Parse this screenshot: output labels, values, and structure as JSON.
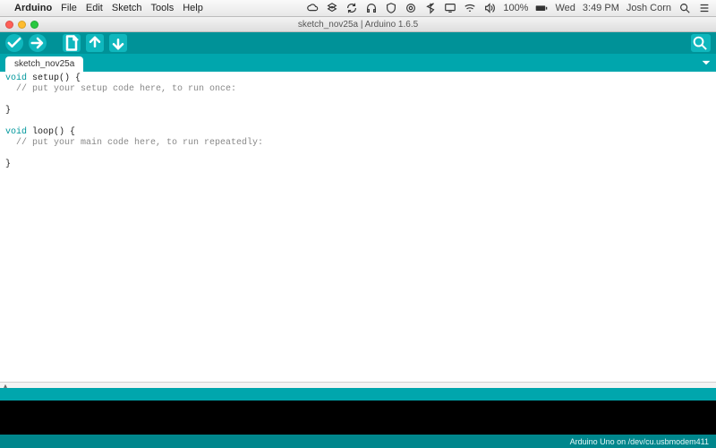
{
  "menubar": {
    "app": "Arduino",
    "items": [
      "File",
      "Edit",
      "Sketch",
      "Tools",
      "Help"
    ],
    "tray": {
      "battery": "100%",
      "day": "Wed",
      "time": "3:49 PM",
      "user": "Josh Corn"
    }
  },
  "window": {
    "title": "sketch_nov25a | Arduino 1.6.5"
  },
  "toolbar": {
    "verify": "verify",
    "upload": "upload",
    "new": "new",
    "open": "open",
    "save": "save",
    "serial": "serial-monitor"
  },
  "tabs": {
    "items": [
      {
        "label": "sketch_nov25a"
      }
    ]
  },
  "code": {
    "l1_kw": "void",
    "l1_rest": " setup() {",
    "l2": "  // put your setup code here, to run once:",
    "l3": "",
    "l4": "}",
    "l5": "",
    "l6_kw": "void",
    "l6_rest": " loop() {",
    "l7": "  // put your main code here, to run repeatedly:",
    "l8": "",
    "l9": "}"
  },
  "status": {
    "board": "Arduino Uno on /dev/cu.usbmodem411"
  },
  "divider": {
    "mark": "▴"
  }
}
